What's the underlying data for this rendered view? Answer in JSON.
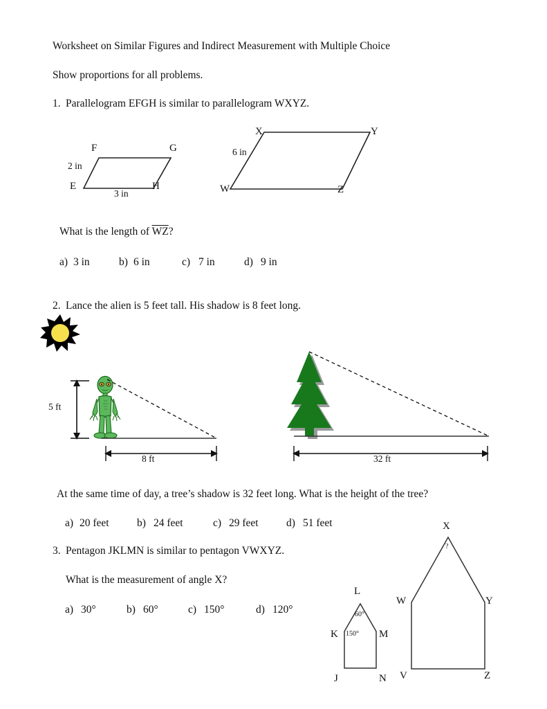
{
  "document": {
    "title": "Worksheet on Similar Figures and Indirect Measurement with Multiple Choice",
    "instruction": "Show proportions for all problems."
  },
  "problem1": {
    "number": "1.",
    "prompt": "Parallelogram EFGH is similar to parallelogram WXYZ.",
    "question_prefix": "What is the length of ",
    "question_segment": "WZ",
    "question_suffix": "?",
    "figure_small": {
      "vertices": {
        "E": "E",
        "F": "F",
        "G": "G",
        "H": "H"
      },
      "side_left": "2 in",
      "side_bottom": "3 in"
    },
    "figure_large": {
      "vertices": {
        "W": "W",
        "X": "X",
        "Y": "Y",
        "Z": "Z"
      },
      "side_left": "6 in"
    },
    "choices": [
      {
        "letter": "a)",
        "text": "3 in"
      },
      {
        "letter": "b)",
        "text": "6 in"
      },
      {
        "letter": "c)",
        "text": "7 in"
      },
      {
        "letter": "d)",
        "text": "9 in"
      }
    ]
  },
  "problem2": {
    "number": "2.",
    "prompt": "Lance the alien is 5 feet tall.  His shadow is 8 feet long.",
    "question": "At the same time of day, a tree’s shadow is 32 feet long.  What is the height of the tree?",
    "alien_height_label": "5 ft",
    "alien_shadow_label": "8 ft",
    "tree_shadow_label": "32 ft",
    "icons": {
      "sun": "sun-icon",
      "alien": "alien-figure",
      "tree": "pine-tree-figure"
    },
    "colors": {
      "sun_center": "#f7e04e",
      "sun_rays": "#000000",
      "alien_body": "#5cb85c",
      "alien_outline": "#1a6b1a",
      "tree_green": "#17791c",
      "tree_shadow": "#9a9a9a"
    },
    "choices": [
      {
        "letter": "a)",
        "text": "20 feet"
      },
      {
        "letter": "b)",
        "text": "24 feet"
      },
      {
        "letter": "c)",
        "text": "29 feet"
      },
      {
        "letter": "d)",
        "text": "51 feet"
      }
    ]
  },
  "problem3": {
    "number": "3.",
    "prompt": "Pentagon JKLMN is similar to pentagon VWXYZ.",
    "question": "What is the measurement of angle X?",
    "figure_small": {
      "vertices": {
        "J": "J",
        "K": "K",
        "L": "L",
        "M": "M",
        "N": "N"
      },
      "angle_apex": "60°",
      "angle_left": "150°"
    },
    "figure_large": {
      "vertices": {
        "V": "V",
        "W": "W",
        "X": "X",
        "Y": "Y",
        "Z": "Z"
      },
      "angle_apex": "?"
    },
    "choices": [
      {
        "letter": "a)",
        "text": "30°"
      },
      {
        "letter": "b)",
        "text": "60°"
      },
      {
        "letter": "c)",
        "text": "150°"
      },
      {
        "letter": "d)",
        "text": "120°"
      }
    ]
  }
}
